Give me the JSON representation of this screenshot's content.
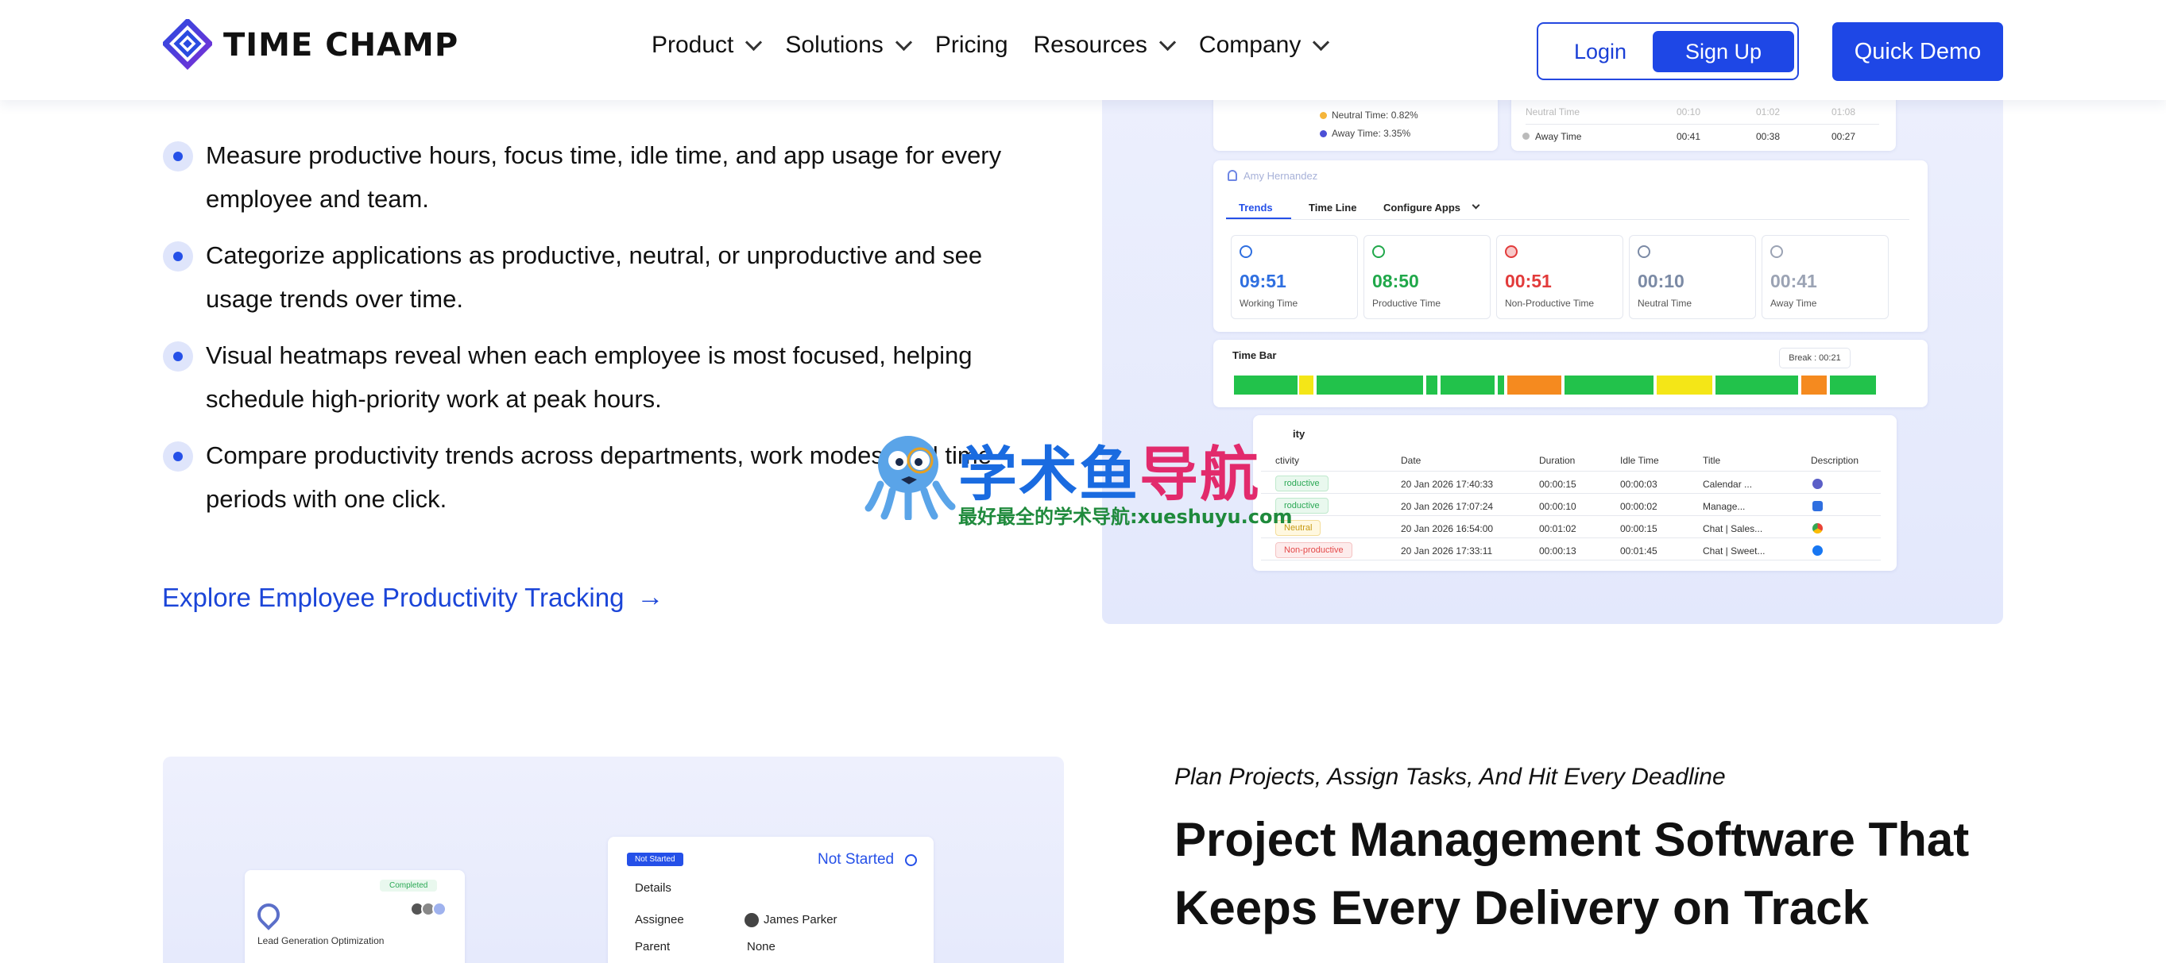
{
  "header": {
    "logo_text": "TIME CHAMP",
    "nav": [
      "Product",
      "Solutions",
      "Pricing",
      "Resources",
      "Company"
    ],
    "login": "Login",
    "signup": "Sign Up",
    "demo": "Quick Demo"
  },
  "features": [
    "Measure productive hours, focus time, idle time, and app usage for every employee and team.",
    "Categorize applications as productive, neutral, or unproductive and see usage trends over time.",
    "Visual heatmaps reveal when each employee is most focused, helping schedule high-priority work at peak hours.",
    "Compare productivity trends across departments, work modes, and time periods with one click."
  ],
  "explore_link": "Explore Employee Productivity Tracking",
  "dashboard": {
    "legend": [
      "Neutral Time: 0.82%",
      "Away Time: 3.35%"
    ],
    "colors": {
      "neutral": "#f5b53b",
      "away": "#4b4fd6",
      "working": "#2f6fe0",
      "productive": "#20a84a",
      "non_productive": "#e23b3b",
      "neutral_time": "#7b8aa5",
      "away_time": "#9ba3b4"
    },
    "top_rows": [
      [
        "Neutral Time",
        "00:10",
        "01:02",
        "01:08"
      ],
      [
        "Away Time",
        "00:41",
        "00:38",
        "00:27"
      ]
    ],
    "user": "Amy Hernandez",
    "tabs": [
      "Trends",
      "Time Line",
      "Configure Apps"
    ],
    "stats": [
      {
        "value": "09:51",
        "label": "Working Time"
      },
      {
        "value": "08:50",
        "label": "Productive Time"
      },
      {
        "value": "00:51",
        "label": "Non-Productive Time"
      },
      {
        "value": "00:10",
        "label": "Neutral Time"
      },
      {
        "value": "00:41",
        "label": "Away Time"
      }
    ],
    "time_bar_title": "Time Bar",
    "break_label": "Break : 00:21",
    "activity_title": "ity",
    "activity_headers": [
      "ctivity",
      "Date",
      "Duration",
      "Idle Time",
      "Title",
      "Description"
    ],
    "activity_rows": [
      {
        "type": "roductive",
        "date": "20 Jan 2026 17:40:33",
        "duration": "00:00:15",
        "idle": "00:00:03",
        "title": "Calendar ..."
      },
      {
        "type": "roductive",
        "date": "20 Jan 2026 17:07:24",
        "duration": "00:00:10",
        "idle": "00:00:02",
        "title": "Manage..."
      },
      {
        "type": "Neutral",
        "date": "20 Jan 2026 16:54:00",
        "duration": "00:01:02",
        "idle": "00:00:15",
        "title": "Chat | Sales..."
      },
      {
        "type": "Non-productive",
        "date": "20 Jan 2026 17:33:11",
        "duration": "00:00:13",
        "idle": "00:01:45",
        "title": "Chat | Sweet..."
      }
    ]
  },
  "project": {
    "completed_badge": "Completed",
    "project_name": "Lead Generation Optimization",
    "status_badge": "Not Started",
    "status_text": "Not Started",
    "details_label": "Details",
    "fields": [
      {
        "label": "Assignee",
        "value": "James Parker"
      },
      {
        "label": "Parent",
        "value": "None"
      }
    ]
  },
  "section2": {
    "subtitle": "Plan Projects, Assign Tasks, And Hit Every Deadline",
    "title": "Project Management Software That Keeps Every Delivery on Track"
  },
  "watermark": {
    "main_blue": "学术鱼",
    "main_pink": "导航",
    "sub": "最好最全的学术导航:xueshuyu.com"
  }
}
